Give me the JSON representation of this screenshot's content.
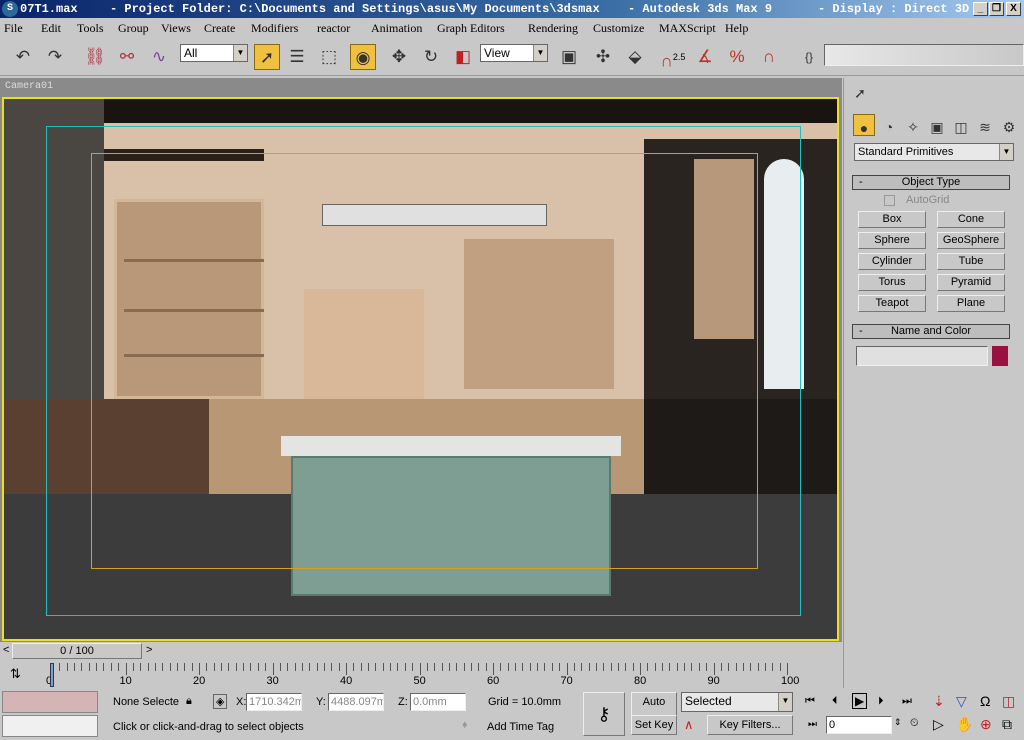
{
  "title": {
    "file": "07T1.max",
    "project": "- Project Folder: C:\\Documents and Settings\\asus\\My Documents\\3dsmax",
    "app": "- Autodesk 3ds Max 9",
    "display": "- Display : Direct 3D",
    "minimize": "_",
    "restore": "❐",
    "close": "X"
  },
  "menu": [
    "File",
    "Edit",
    "Tools",
    "Group",
    "Views",
    "Create",
    "Modifiers",
    "reactor",
    "Animation",
    "Graph Editors",
    "Rendering",
    "Customize",
    "MAXScript",
    "Help"
  ],
  "toolbar": {
    "selection_filter": "All",
    "ref_coord": "View",
    "snap_label": "2.5"
  },
  "viewport": {
    "label": "Camera01"
  },
  "panel": {
    "category": "Standard Primitives",
    "object_type": "Object Type",
    "autogrid": "AutoGrid",
    "buttons": [
      "Box",
      "Cone",
      "Sphere",
      "GeoSphere",
      "Cylinder",
      "Tube",
      "Torus",
      "Pyramid",
      "Teapot",
      "Plane"
    ],
    "name_color": "Name and Color",
    "name_value": "",
    "color": "#9a1040"
  },
  "timeline": {
    "frame": "0 / 100",
    "prev": "<",
    "next": ">",
    "ticks": [
      "0",
      "10",
      "20",
      "30",
      "40",
      "50",
      "60",
      "70",
      "80",
      "90",
      "100"
    ],
    "current_fraction": 0
  },
  "status": {
    "selection": "None Selecte",
    "x_label": "X:",
    "x": "1710.342m",
    "y_label": "Y:",
    "y": "4488.097m",
    "z_label": "Z:",
    "z": "0.0mm",
    "grid": "Grid = 10.0mm",
    "prompt": "Click or click-and-drag to select objects",
    "add_time_tag": "Add Time Tag",
    "auto_key": "Auto Key",
    "set_key": "Set Key",
    "key_mode": "Selected",
    "key_filters": "Key Filters...",
    "current_frame": "0"
  }
}
